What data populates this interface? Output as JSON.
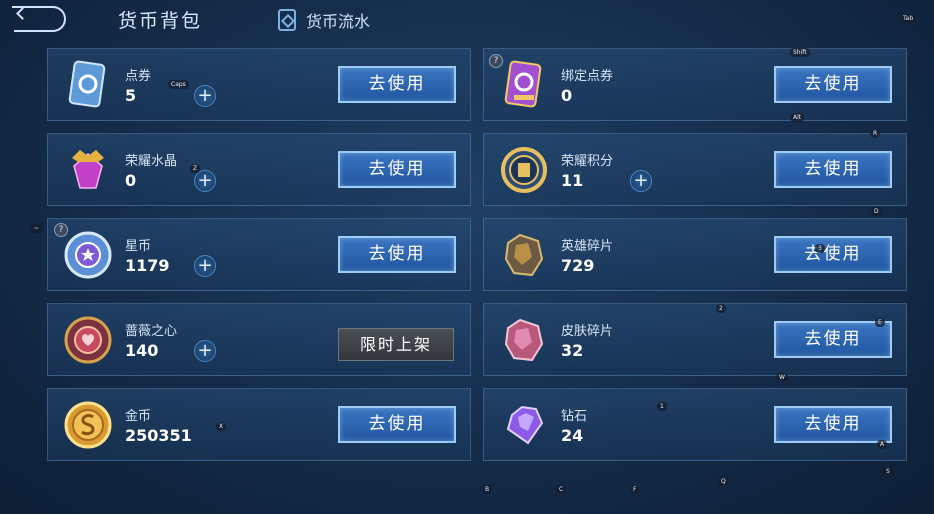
{
  "header": {
    "title": "货币背包",
    "flow_tab": "货币流水"
  },
  "currencies": [
    {
      "name": "点券",
      "value": "5",
      "plus": "+",
      "action": "去使用",
      "icon": "ticket-icon"
    },
    {
      "name": "绑定点券",
      "value": "0",
      "action": "去使用",
      "icon": "bound-ticket-icon"
    },
    {
      "name": "荣耀水晶",
      "value": "0",
      "plus": "+",
      "action": "去使用",
      "icon": "glory-crystal-icon"
    },
    {
      "name": "荣耀积分",
      "value": "11",
      "plus": "+",
      "action": "去使用",
      "icon": "glory-points-icon"
    },
    {
      "name": "星币",
      "value": "1179",
      "plus": "+",
      "action": "去使用",
      "icon": "star-coin-icon"
    },
    {
      "name": "英雄碎片",
      "value": "729",
      "action": "去使用",
      "icon": "hero-fragment-icon"
    },
    {
      "name": "蔷薇之心",
      "value": "140",
      "plus": "+",
      "action": "限时上架",
      "icon": "rose-heart-icon"
    },
    {
      "name": "皮肤碎片",
      "value": "32",
      "action": "去使用",
      "icon": "skin-fragment-icon"
    },
    {
      "name": "金币",
      "value": "250351",
      "action": "去使用",
      "icon": "gold-coin-icon"
    },
    {
      "name": "钻石",
      "value": "24",
      "action": "去使用",
      "icon": "diamond-icon"
    }
  ],
  "help_mark": "?",
  "key_hints": [
    "Tab",
    "Shift",
    "Alt",
    "R",
    "Caps",
    "Z",
    "D",
    "~",
    "3",
    "2",
    "E",
    "W",
    "1",
    "X",
    "A",
    "S",
    "Q",
    "B",
    "C",
    "F"
  ],
  "colors": {
    "accent_button": "#2d66b3",
    "limited_button": "#3f444a",
    "background": "#142c4a"
  }
}
